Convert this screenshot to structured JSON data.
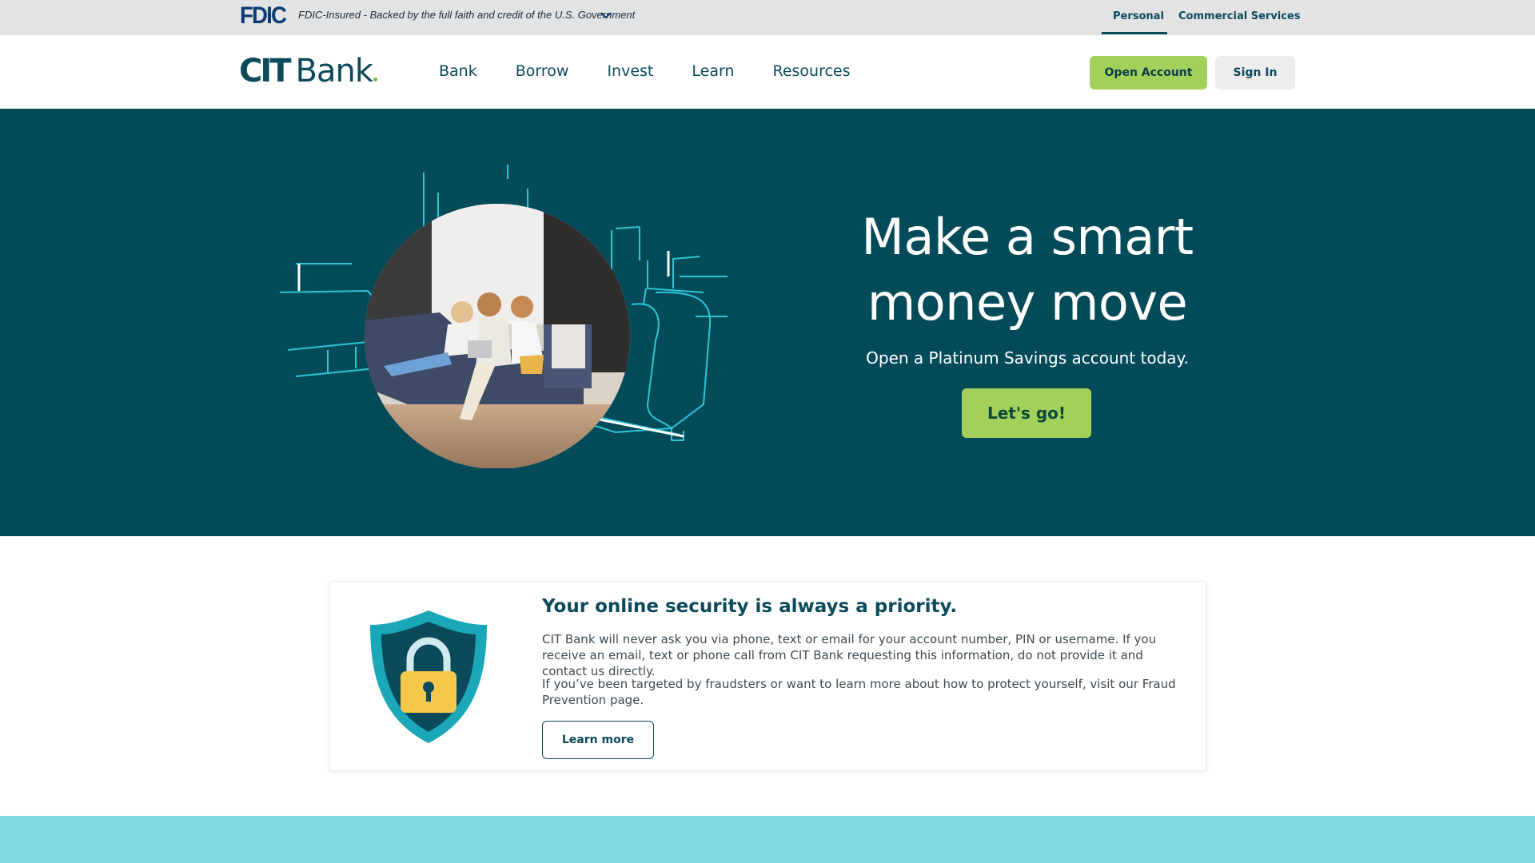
{
  "topbar": {
    "fdic_logo": "FDIC",
    "fdic_text": "FDIC-Insured - Backed by the full faith and credit of the U.S. Government",
    "segments": [
      "Personal",
      "Commercial Services"
    ],
    "active_segment": "Personal"
  },
  "header": {
    "logo_cit": "CIT",
    "logo_bank": "Bank",
    "nav": [
      "Bank",
      "Borrow",
      "Invest",
      "Learn",
      "Resources"
    ],
    "open_account": "Open Account",
    "sign_in": "Sign In"
  },
  "hero": {
    "title_line1": "Make a smart",
    "title_line2": "money move",
    "subtitle": "Open a Platinum Savings account today.",
    "cta": "Let's go!"
  },
  "security": {
    "title": "Your online security is always a priority.",
    "p1": "CIT Bank will never ask you via phone, text or email for your account number, PIN or username. If you receive an email, text or phone call from CIT Bank requesting this information, do not provide it and contact us directly.",
    "p2": "If you’ve been targeted by fraudsters or want to learn more about how to protect yourself, visit our Fraud Prevention page.",
    "cta": "Learn more"
  },
  "colors": {
    "brand_teal": "#044b5a",
    "accent_green": "#a2d05a",
    "line_cyan": "#2ec4d6",
    "band_aqua": "#7fd8de",
    "shield_yellow": "#f5c84c"
  },
  "icons": {
    "fdic_dropdown": "chevron-down-icon",
    "security": "shield-lock-icon"
  }
}
